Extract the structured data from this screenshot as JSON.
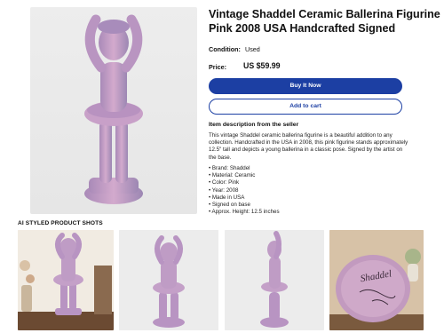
{
  "listing": {
    "title": "Vintage Shaddel Ceramic Ballerina Figurine Pink 2008 USA Handcrafted Signed",
    "condition_label": "Condition:",
    "condition_value": "Used",
    "price_label": "Price:",
    "price_value": "US $59.99"
  },
  "actions": {
    "buy_now": "Buy It Now",
    "add_to_cart": "Add to cart"
  },
  "description": {
    "heading": "Item description from the seller",
    "body": "This vintage Shaddel ceramic ballerina figurine is a beautiful addition to any collection. Handcrafted in the USA in 2008, this pink figurine stands approximately 12.5\" tall and depicts a young ballerina in a classic pose. Signed by the artist on the base.",
    "features": [
      "Brand: Shaddel",
      "Material: Ceramic",
      "Color: Pink",
      "Year: 2008",
      "Made in USA",
      "Signed on base",
      "Approx. Height: 12.5 inches"
    ]
  },
  "gallery": {
    "heading": "AI STYLED PRODUCT SHOTS",
    "signature_text": "Shaddel"
  },
  "colors": {
    "accent": "#1c3fa3",
    "figurine": "#c9a3c6"
  }
}
